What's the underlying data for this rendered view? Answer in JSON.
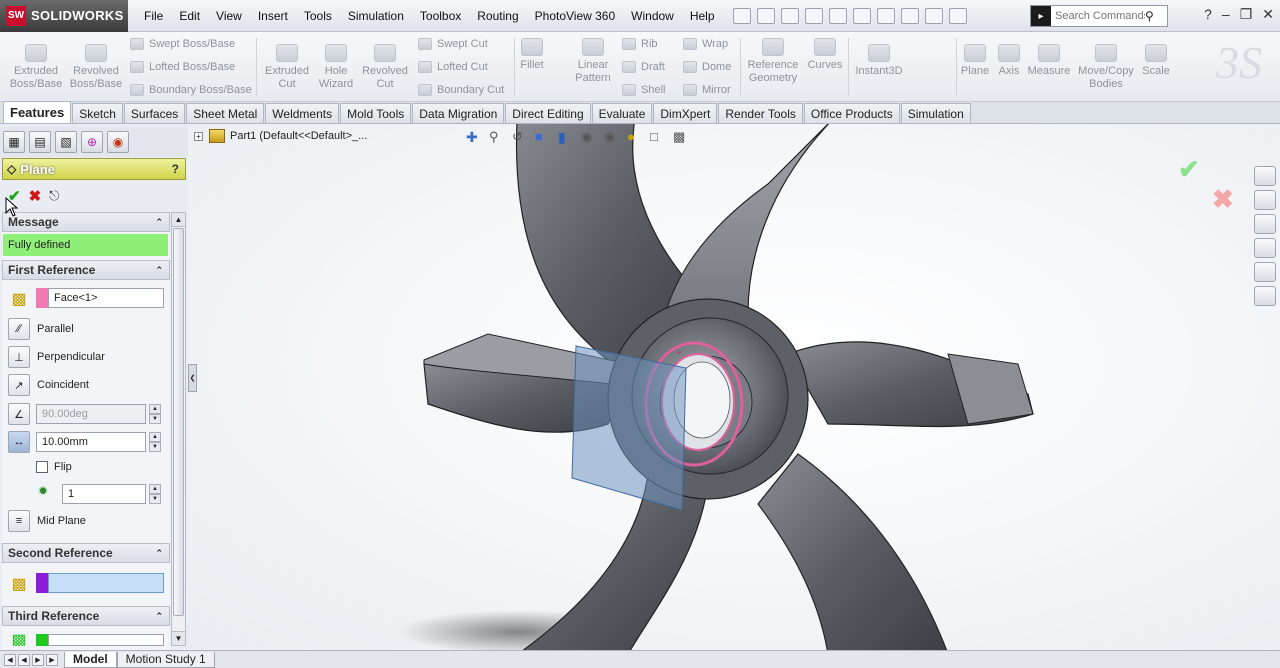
{
  "app": {
    "brand": "SOLIDWORKS",
    "brand_mark": "SW"
  },
  "menus": [
    "File",
    "Edit",
    "View",
    "Insert",
    "Tools",
    "Simulation",
    "Toolbox",
    "Routing",
    "PhotoView 360",
    "Window",
    "Help"
  ],
  "search": {
    "placeholder": "Search Commands"
  },
  "commands": {
    "extruded_boss": "Extruded\nBoss/Base",
    "revolved_boss": "Revolved\nBoss/Base",
    "swept_boss": "Swept Boss/Base",
    "lofted_boss": "Lofted Boss/Base",
    "boundary_boss": "Boundary Boss/Base",
    "extruded_cut": "Extruded\nCut",
    "hole_wizard": "Hole\nWizard",
    "revolved_cut": "Revolved\nCut",
    "swept_cut": "Swept Cut",
    "lofted_cut": "Lofted Cut",
    "boundary_cut": "Boundary Cut",
    "fillet": "Fillet",
    "linear_pattern": "Linear\nPattern",
    "rib": "Rib",
    "draft": "Draft",
    "shell": "Shell",
    "wrap": "Wrap",
    "dome": "Dome",
    "mirror": "Mirror",
    "reference_geometry": "Reference\nGeometry",
    "curves": "Curves",
    "instant3d": "Instant3D",
    "plane": "Plane",
    "axis": "Axis",
    "measure": "Measure",
    "move_copy": "Move/Copy\nBodies",
    "scale": "Scale"
  },
  "tabs": [
    "Features",
    "Sketch",
    "Surfaces",
    "Sheet Metal",
    "Weldments",
    "Mold Tools",
    "Data Migration",
    "Direct Editing",
    "Evaluate",
    "DimXpert",
    "Render Tools",
    "Office Products",
    "Simulation"
  ],
  "active_tab": "Features",
  "feature_tree": {
    "root": "Part1  (Default<<Default>_..."
  },
  "property_manager": {
    "title": "Plane",
    "help": "?",
    "message_header": "Message",
    "message": "Fully defined",
    "first_reference": {
      "header": "First Reference",
      "selection": "Face<1>",
      "parallel": "Parallel",
      "perpendicular": "Perpendicular",
      "coincident": "Coincident",
      "angle": "90.00deg",
      "distance": "10.00mm",
      "flip": "Flip",
      "count": "1",
      "mid_plane": "Mid Plane"
    },
    "second_reference": {
      "header": "Second Reference",
      "selection": ""
    },
    "third_reference": {
      "header": "Third Reference",
      "selection": ""
    }
  },
  "bottom_tabs": [
    "Model",
    "Motion Study 1"
  ],
  "colors": {
    "accent_brand": "#c8102e",
    "message_bg": "#8ef078",
    "ref1_chip": "#f07ab4",
    "ref2_chip": "#8a1ed8",
    "ref3_chip": "#1ec81e",
    "plane_fill": "#6f93bf",
    "edge_select": "#e0609e"
  }
}
